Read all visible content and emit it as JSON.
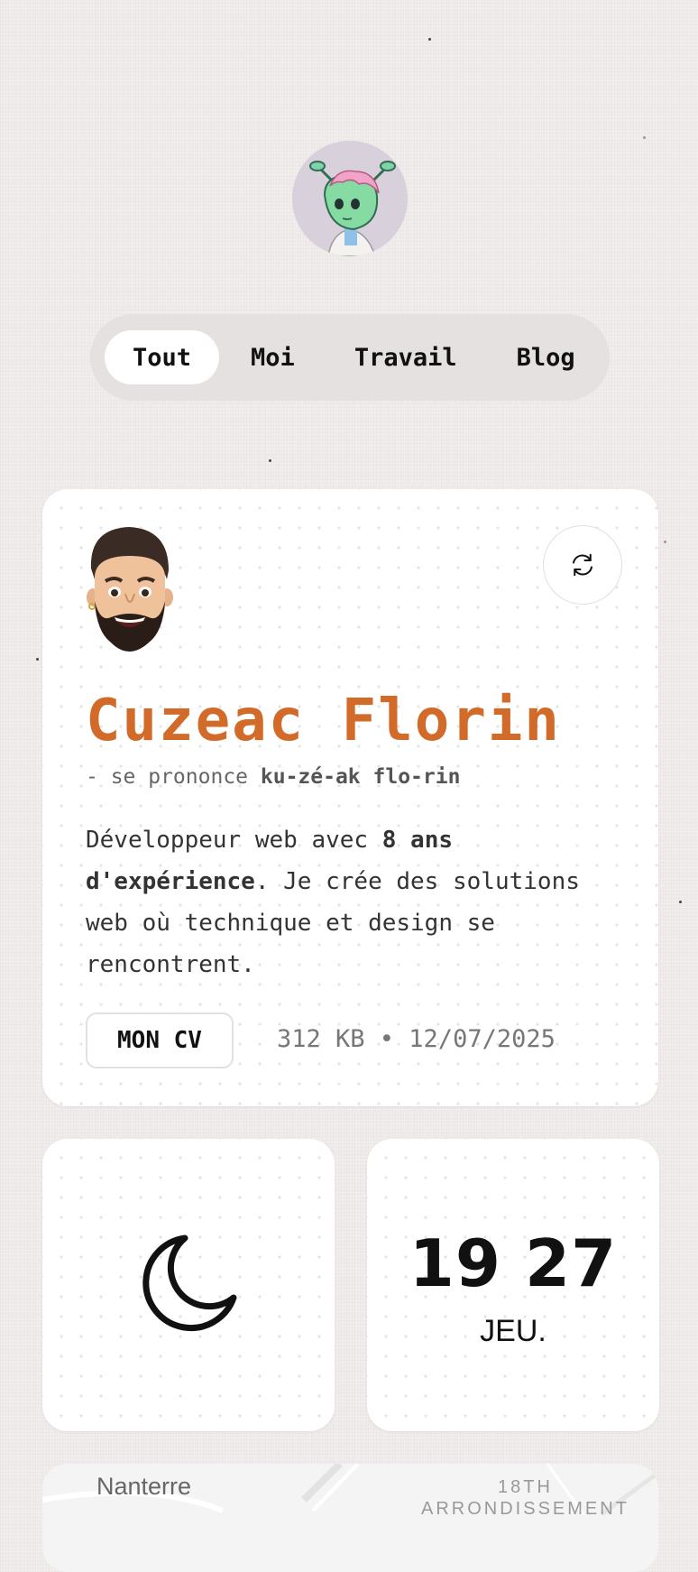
{
  "nav": {
    "tabs": [
      {
        "label": "Tout",
        "active": true
      },
      {
        "label": "Moi",
        "active": false
      },
      {
        "label": "Travail",
        "active": false
      },
      {
        "label": "Blog",
        "active": false
      }
    ]
  },
  "profile": {
    "name": "Cuzeac Florin",
    "pronounce_prefix": "- se prononce ",
    "pronounce": "ku-zé-ak flo-rin",
    "bio_part1": "Développeur web avec ",
    "bio_bold": "8 ans d'expérience",
    "bio_part2": ". Je crée des solutions web où technique et design se rencontrent.",
    "cv_label": "MON CV",
    "cv_meta": "312 KB • 12/07/2025",
    "accent_color": "#d26a2a"
  },
  "clock": {
    "time": "19 27",
    "day": "JEU."
  },
  "map": {
    "label_city": "Nanterre",
    "label_district_line1": "18TH",
    "label_district_line2": "ARRONDISSEMENT"
  }
}
